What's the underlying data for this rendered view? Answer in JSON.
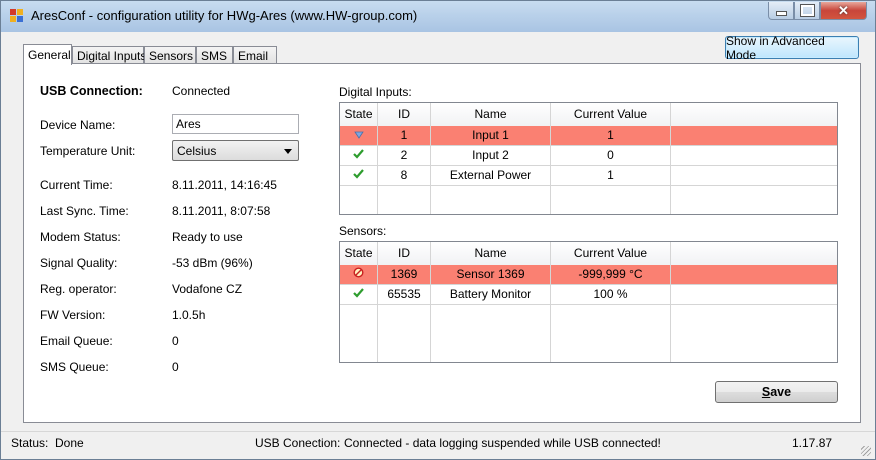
{
  "window": {
    "title": "AresConf - configuration utility for HWg-Ares (www.HW-group.com)",
    "controls": {
      "minimize": "minimize",
      "maximize": "maximize",
      "close": "✕"
    }
  },
  "tabs": [
    {
      "label": "General",
      "active": true
    },
    {
      "label": "Digital Inputs",
      "active": false
    },
    {
      "label": "Sensors",
      "active": false
    },
    {
      "label": "SMS",
      "active": false
    },
    {
      "label": "Email",
      "active": false
    }
  ],
  "advanced_button": "Show in Advanced Mode",
  "general": {
    "usb_label": "USB Connection:",
    "usb_value": "Connected",
    "device_name_label": "Device Name:",
    "device_name_value": "Ares",
    "temp_unit_label": "Temperature Unit:",
    "temp_unit_value": "Celsius",
    "current_time_label": "Current Time:",
    "current_time_value": "8.11.2011, 14:16:45",
    "last_sync_label": "Last Sync. Time:",
    "last_sync_value": "8.11.2011, 8:07:58",
    "modem_status_label": "Modem Status:",
    "modem_status_value": "Ready to use",
    "signal_label": "Signal Quality:",
    "signal_value": "-53 dBm (96%)",
    "operator_label": "Reg. operator:",
    "operator_value": "Vodafone CZ",
    "fw_label": "FW Version:",
    "fw_value": "1.0.5h",
    "email_queue_label": "Email Queue:",
    "email_queue_value": "0",
    "sms_queue_label": "SMS Queue:",
    "sms_queue_value": "0"
  },
  "digital_inputs": {
    "title": "Digital Inputs:",
    "columns": [
      "State",
      "ID",
      "Name",
      "Current Value"
    ],
    "rows": [
      {
        "state": "alarm-arrow-icon",
        "id": "1",
        "name": "Input 1",
        "value": "1",
        "alert": true
      },
      {
        "state": "check-icon",
        "id": "2",
        "name": "Input 2",
        "value": "0",
        "alert": false
      },
      {
        "state": "check-icon",
        "id": "8",
        "name": "External Power",
        "value": "1",
        "alert": false
      }
    ]
  },
  "sensors": {
    "title": "Sensors:",
    "columns": [
      "State",
      "ID",
      "Name",
      "Current Value"
    ],
    "rows": [
      {
        "state": "error-icon",
        "id": "1369",
        "name": "Sensor 1369",
        "value": "-999,999 °C",
        "alert": true
      },
      {
        "state": "check-icon",
        "id": "65535",
        "name": "Battery Monitor",
        "value": "100 %",
        "alert": false
      }
    ]
  },
  "save_button": {
    "prefix": "",
    "accel": "S",
    "rest": "ave"
  },
  "status_bar": {
    "status_label": "Status:",
    "status_value": "Done",
    "usb_label": "USB Conection:",
    "usb_value": "Connected - data logging suspended while USB connected!",
    "version": "1.17.87"
  },
  "colors": {
    "alert_row": "#fa8072",
    "ok_check": "#2e9d2e"
  }
}
